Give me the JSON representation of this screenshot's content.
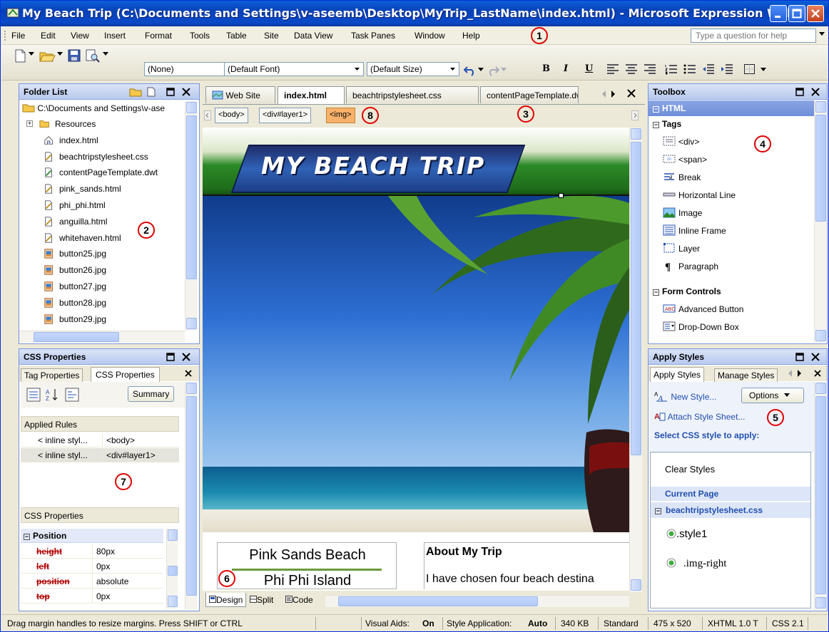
{
  "window": {
    "title": "My Beach Trip (C:\\Documents and Settings\\v-aseemb\\Desktop\\MyTrip_LastName\\index.html) - Microsoft Expression Web"
  },
  "menu": {
    "items": [
      "File",
      "Edit",
      "View",
      "Insert",
      "Format",
      "Tools",
      "Table",
      "Site",
      "Data View",
      "Task Panes",
      "Window",
      "Help"
    ],
    "help_placeholder": "Type a question for help"
  },
  "toolbar": {
    "style_combo": "(None)",
    "font_combo": "(Default Font)",
    "size_combo": "(Default Size)",
    "bold": "B",
    "italic": "I",
    "underline": "U"
  },
  "folder_list": {
    "title": "Folder List",
    "root": "C:\\Documents and Settings\\v-ase",
    "items": [
      {
        "name": "Resources",
        "icon": "folder-icon"
      },
      {
        "name": "index.html",
        "icon": "home-page-icon"
      },
      {
        "name": "beachtripstylesheet.css",
        "icon": "css-file-icon"
      },
      {
        "name": "contentPageTemplate.dwt",
        "icon": "template-file-icon"
      },
      {
        "name": "pink_sands.html",
        "icon": "html-file-icon"
      },
      {
        "name": "phi_phi.html",
        "icon": "html-file-icon"
      },
      {
        "name": "anguilla.html",
        "icon": "html-file-icon"
      },
      {
        "name": "whitehaven.html",
        "icon": "html-file-icon"
      },
      {
        "name": "button25.jpg",
        "icon": "image-file-icon"
      },
      {
        "name": "button26.jpg",
        "icon": "image-file-icon"
      },
      {
        "name": "button27.jpg",
        "icon": "image-file-icon"
      },
      {
        "name": "button28.jpg",
        "icon": "image-file-icon"
      },
      {
        "name": "button29.jpg",
        "icon": "image-file-icon"
      }
    ]
  },
  "css_panel": {
    "title": "CSS Properties",
    "tabs": [
      "Tag Properties",
      "CSS Properties"
    ],
    "summary_button": "Summary",
    "applied_rules_header": "Applied Rules",
    "applied_rules": [
      {
        "source": "< inline styl...",
        "selector": "<body>"
      },
      {
        "source": "< inline styl...",
        "selector": "<div#layer1>"
      }
    ],
    "properties_header": "CSS Properties",
    "group": "Position",
    "properties": [
      {
        "name": "height",
        "value": "80px"
      },
      {
        "name": "left",
        "value": "0px"
      },
      {
        "name": "position",
        "value": "absolute"
      },
      {
        "name": "top",
        "value": "0px"
      }
    ]
  },
  "editor": {
    "tabs": [
      "Web Site",
      "index.html",
      "beachtripstylesheet.css",
      "contentPageTemplate.dwt"
    ],
    "breadcrumbs": [
      "<body>",
      "<div#layer1>",
      "<img>"
    ],
    "banner_text": "MY BEACH TRIP",
    "nav_links": [
      "Pink Sands Beach",
      "Phi Phi Island"
    ],
    "about_heading": "About My Trip",
    "about_text": "I have chosen four beach destina",
    "view_tabs": [
      "Design",
      "Split",
      "Code"
    ]
  },
  "toolbox": {
    "title": "Toolbox",
    "html_header": "HTML",
    "tags_header": "Tags",
    "tags": [
      {
        "label": "<div>",
        "icon": "div-icon"
      },
      {
        "label": "<span>",
        "icon": "span-icon"
      },
      {
        "label": "Break",
        "icon": "break-icon"
      },
      {
        "label": "Horizontal Line",
        "icon": "horizontal-line-icon"
      },
      {
        "label": "Image",
        "icon": "image-icon"
      },
      {
        "label": "Inline Frame",
        "icon": "inline-frame-icon"
      },
      {
        "label": "Layer",
        "icon": "layer-icon"
      },
      {
        "label": "Paragraph",
        "icon": "paragraph-icon"
      }
    ],
    "form_header": "Form Controls",
    "form_controls": [
      {
        "label": "Advanced Button",
        "icon": "advanced-button-icon"
      },
      {
        "label": "Drop-Down Box",
        "icon": "drop-down-box-icon"
      }
    ]
  },
  "apply_styles": {
    "title": "Apply Styles",
    "tabs": [
      "Apply Styles",
      "Manage Styles"
    ],
    "new_style": "New Style...",
    "options": "Options",
    "attach": "Attach Style Sheet...",
    "select_label": "Select CSS style to apply:",
    "clear": "Clear Styles",
    "current_page": "Current Page",
    "sheet": "beachtripstylesheet.css",
    "styles": [
      ".style1",
      ".img-right"
    ]
  },
  "status": {
    "hint": "Drag margin handles to resize margins. Press SHIFT or CTRL",
    "visual_aids_label": "Visual Aids:",
    "visual_aids_value": "On",
    "style_app_label": "Style Application:",
    "style_app_value": "Auto",
    "size": "340 KB",
    "mode": "Standard",
    "dims": "475 x 520",
    "doctype": "XHTML 1.0 T",
    "css": "CSS 2.1"
  },
  "callouts": [
    "1",
    "2",
    "3",
    "4",
    "5",
    "6",
    "7",
    "8"
  ],
  "colors": {
    "title_bar": "#0a49c8",
    "panel_header": "#b7c9ee",
    "breadcrumb_highlight": "#f7b16a",
    "callout": "#e00000"
  }
}
